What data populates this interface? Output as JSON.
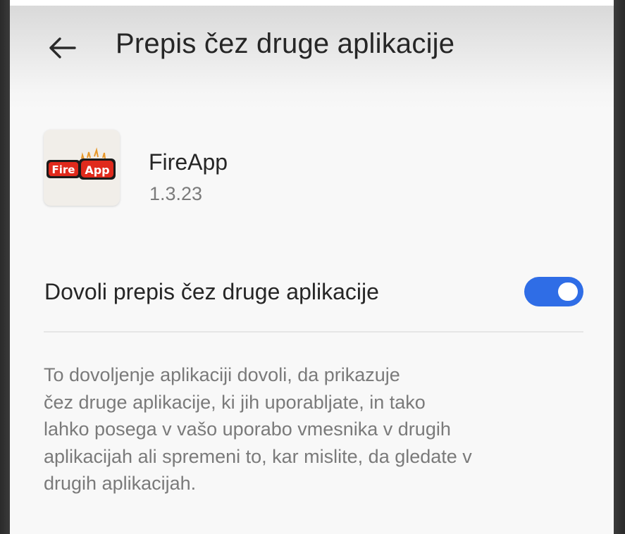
{
  "header": {
    "back_icon": "arrow-back-icon",
    "title": "Prepis čez druge aplikacije"
  },
  "app": {
    "icon_text_fire": "Fire",
    "icon_text_app": "App",
    "name": "FireApp",
    "version": "1.3.23"
  },
  "setting": {
    "label": "Dovoli prepis čez druge aplikacije",
    "enabled": true,
    "accent_color": "#2f6de6"
  },
  "description": {
    "lines": [
      "To dovoljenje aplikaciji dovoli, da prikazuje",
      "čez druge aplikacije, ki jih uporabljate, in tako",
      "lahko posega v vašo uporabo vmesnika v drugih",
      "aplikacijah ali spremeni to, kar mislite, da gledate v",
      "drugih aplikacijah."
    ]
  }
}
